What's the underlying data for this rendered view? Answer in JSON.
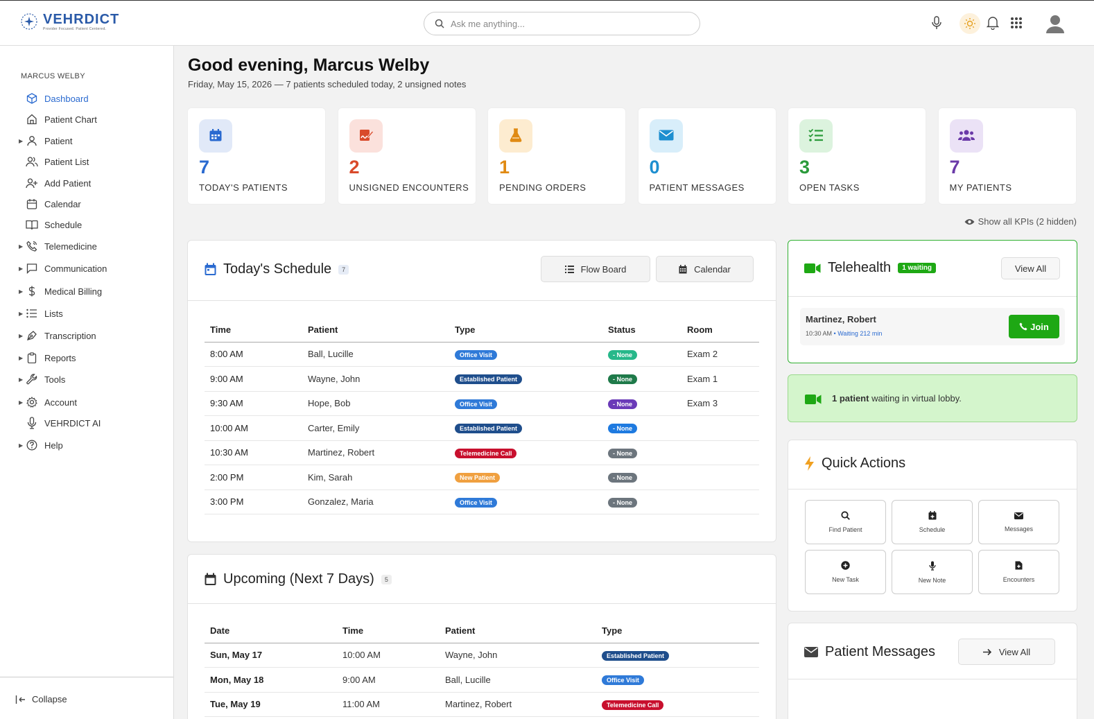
{
  "header": {
    "logo_name": "VEHRDICT",
    "logo_tagline": "Provider Focused. Patient Centered.",
    "search_placeholder": "Ask me anything..."
  },
  "sidebar": {
    "user": "MARCUS WELBY",
    "items": [
      {
        "label": "Dashboard",
        "icon": "cube-icon",
        "caret": false,
        "active": true
      },
      {
        "label": "Patient Chart",
        "icon": "home-icon",
        "caret": false
      },
      {
        "label": "Patient",
        "icon": "user-icon",
        "caret": true
      },
      {
        "label": "Patient List",
        "icon": "users-icon",
        "caret": false
      },
      {
        "label": "Add Patient",
        "icon": "user-plus-icon",
        "caret": false
      },
      {
        "label": "Calendar",
        "icon": "calendar-icon",
        "caret": false
      },
      {
        "label": "Schedule",
        "icon": "book-icon",
        "caret": false
      },
      {
        "label": "Telemedicine",
        "icon": "phone-icon",
        "caret": true
      },
      {
        "label": "Communication",
        "icon": "message-icon",
        "caret": true
      },
      {
        "label": "Medical Billing",
        "icon": "dollar-icon",
        "caret": true
      },
      {
        "label": "Lists",
        "icon": "list-icon",
        "caret": true
      },
      {
        "label": "Transcription",
        "icon": "pen-icon",
        "caret": true
      },
      {
        "label": "Reports",
        "icon": "clipboard-icon",
        "caret": true
      },
      {
        "label": "Tools",
        "icon": "wrench-icon",
        "caret": true
      },
      {
        "label": "Account",
        "icon": "gear-icon",
        "caret": true
      },
      {
        "label": "VEHRDICT AI",
        "icon": "mic-icon",
        "caret": false
      },
      {
        "label": "Help",
        "icon": "help-icon",
        "caret": true
      }
    ],
    "collapse_label": "Collapse"
  },
  "greeting": {
    "title": "Good evening, Marcus Welby",
    "subtitle": "Friday, May 15, 2026 — 7 patients scheduled today, 2 unsigned notes"
  },
  "kpis": [
    {
      "value": "7",
      "label": "TODAY'S PATIENTS",
      "color": "#2a6ad0",
      "bg": "#e1e9f8",
      "icon": "calendar-icon"
    },
    {
      "value": "2",
      "label": "UNSIGNED ENCOUNTERS",
      "color": "#d94a2a",
      "bg": "#fbe1dc",
      "icon": "signature-icon"
    },
    {
      "value": "1",
      "label": "PENDING ORDERS",
      "color": "#e08a12",
      "bg": "#fdecd0",
      "icon": "flask-icon"
    },
    {
      "value": "0",
      "label": "PATIENT MESSAGES",
      "color": "#1e8fd0",
      "bg": "#d8eefa",
      "icon": "envelope-icon"
    },
    {
      "value": "3",
      "label": "OPEN TASKS",
      "color": "#2a9a3a",
      "bg": "#dcf3de",
      "icon": "tasks-icon"
    },
    {
      "value": "7",
      "label": "MY PATIENTS",
      "color": "#6a3aa8",
      "bg": "#ebe2f6",
      "icon": "group-icon"
    }
  ],
  "show_kpis": "Show all KPIs (2 hidden)",
  "schedule": {
    "title": "Today's Schedule",
    "count": "7",
    "flow_board": "Flow Board",
    "calendar": "Calendar",
    "columns": [
      "Time",
      "Patient",
      "Type",
      "Status",
      "Room"
    ],
    "rows": [
      {
        "time": "8:00 AM",
        "patient": "Ball, Lucille",
        "type": "Office Visit",
        "type_color": "#2f7ad8",
        "status": "- None",
        "status_color": "#27b88a",
        "room": "Exam 2"
      },
      {
        "time": "9:00 AM",
        "patient": "Wayne, John",
        "type": "Established Patient",
        "type_color": "#1f4e8c",
        "status": "- None",
        "status_color": "#1f7a4a",
        "room": "Exam 1"
      },
      {
        "time": "9:30 AM",
        "patient": "Hope, Bob",
        "type": "Office Visit",
        "type_color": "#2f7ad8",
        "status": "- None",
        "status_color": "#6a3ab8",
        "room": "Exam 3"
      },
      {
        "time": "10:00 AM",
        "patient": "Carter, Emily",
        "type": "Established Patient",
        "type_color": "#1f4e8c",
        "status": "- None",
        "status_color": "#1e7ae0",
        "room": ""
      },
      {
        "time": "10:30 AM",
        "patient": "Martinez, Robert",
        "type": "Telemedicine Call",
        "type_color": "#c8102e",
        "status": "- None",
        "status_color": "#6c757d",
        "room": ""
      },
      {
        "time": "2:00 PM",
        "patient": "Kim, Sarah",
        "type": "New Patient",
        "type_color": "#f0a040",
        "status": "- None",
        "status_color": "#6c757d",
        "room": ""
      },
      {
        "time": "3:00 PM",
        "patient": "Gonzalez, Maria",
        "type": "Office Visit",
        "type_color": "#2f7ad8",
        "status": "- None",
        "status_color": "#6c757d",
        "room": ""
      }
    ]
  },
  "upcoming": {
    "title": "Upcoming (Next 7 Days)",
    "count": "5",
    "columns": [
      "Date",
      "Time",
      "Patient",
      "Type"
    ],
    "rows": [
      {
        "date": "Sun, May 17",
        "time": "10:00 AM",
        "patient": "Wayne, John",
        "type": "Established Patient",
        "type_color": "#1f4e8c"
      },
      {
        "date": "Mon, May 18",
        "time": "9:00 AM",
        "patient": "Ball, Lucille",
        "type": "Office Visit",
        "type_color": "#2f7ad8"
      },
      {
        "date": "Tue, May 19",
        "time": "11:00 AM",
        "patient": "Martinez, Robert",
        "type": "Telemedicine Call",
        "type_color": "#c8102e"
      }
    ]
  },
  "telehealth": {
    "title": "Telehealth",
    "badge": "1 waiting",
    "view_all": "View All",
    "patient": "Martinez, Robert",
    "time": "10:30 AM",
    "waiting": "Waiting 212 min",
    "join": "Join",
    "lobby_bold": "1 patient",
    "lobby_rest": " waiting in virtual lobby."
  },
  "quick_actions": {
    "title": "Quick Actions",
    "items": [
      {
        "label": "Find Patient",
        "icon": "search-icon"
      },
      {
        "label": "Schedule",
        "icon": "calendar-plus-icon"
      },
      {
        "label": "Messages",
        "icon": "envelope-icon"
      },
      {
        "label": "New Task",
        "icon": "plus-circle-icon"
      },
      {
        "label": "New Note",
        "icon": "mic-icon"
      },
      {
        "label": "Encounters",
        "icon": "file-medical-icon"
      }
    ]
  },
  "patient_messages": {
    "title": "Patient Messages",
    "view_all": "View All"
  }
}
